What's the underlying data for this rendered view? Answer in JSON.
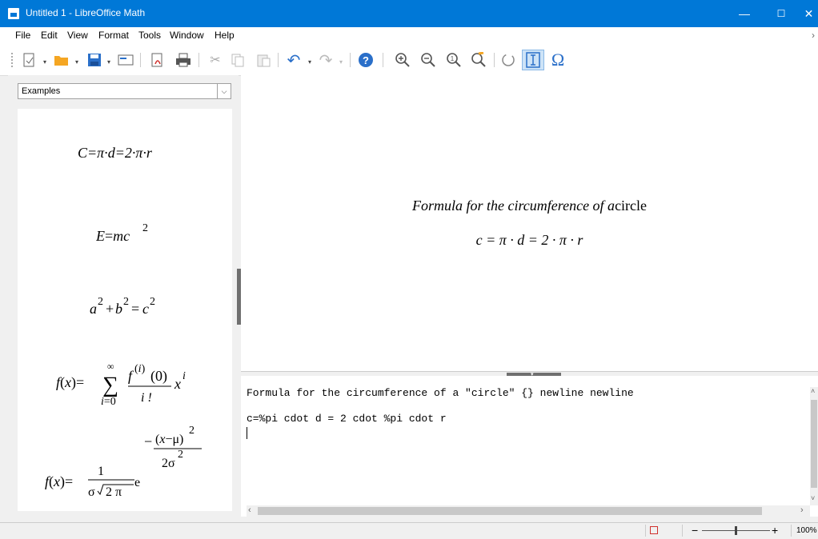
{
  "window": {
    "title": "Untitled 1 - LibreOffice Math",
    "minimize": "—",
    "maximize": "☐",
    "close": "✕"
  },
  "menu": {
    "items": [
      {
        "label": "File"
      },
      {
        "label": "Edit"
      },
      {
        "label": "View"
      },
      {
        "label": "Format"
      },
      {
        "label": "Tools"
      },
      {
        "label": "Window"
      },
      {
        "label": "Help"
      }
    ],
    "overflow": "›"
  },
  "toolbar": {
    "icons": [
      "new-icon",
      "open-icon",
      "save-icon",
      "email-icon",
      "export-pdf-icon",
      "print-icon",
      "cut-icon",
      "copy-icon",
      "paste-icon",
      "undo-icon",
      "redo-icon",
      "help-icon",
      "zoom-in-icon",
      "zoom-out-icon",
      "show-all-icon",
      "zoom-icon",
      "update-icon",
      "formula-cursor-icon",
      "symbols-icon"
    ],
    "symbols_glyph": "Ω"
  },
  "sidebar": {
    "category_selected": "Examples",
    "examples": [
      "C = π·d = 2·π·r",
      "E = mc²",
      "a² + b² = c²",
      "f(x) = Σ f⁽ⁱ⁾(0) / i! xⁱ",
      "f(x) = 1/(σ√2π) e^(−(x−μ)²/2σ²)"
    ]
  },
  "preview": {
    "text_italic": "Formula for the circumference of a",
    "text_plain": "circle",
    "equation": "c = π · d = 2 · π · r"
  },
  "editor": {
    "line1": "Formula for the circumference of a \"circle\" {} newline newline",
    "line2": "",
    "line3": "c=%pi cdot d = 2 cdot %pi cdot r"
  },
  "statusbar": {
    "zoom": "100%",
    "zoom_minus": "−",
    "zoom_plus": "+"
  }
}
